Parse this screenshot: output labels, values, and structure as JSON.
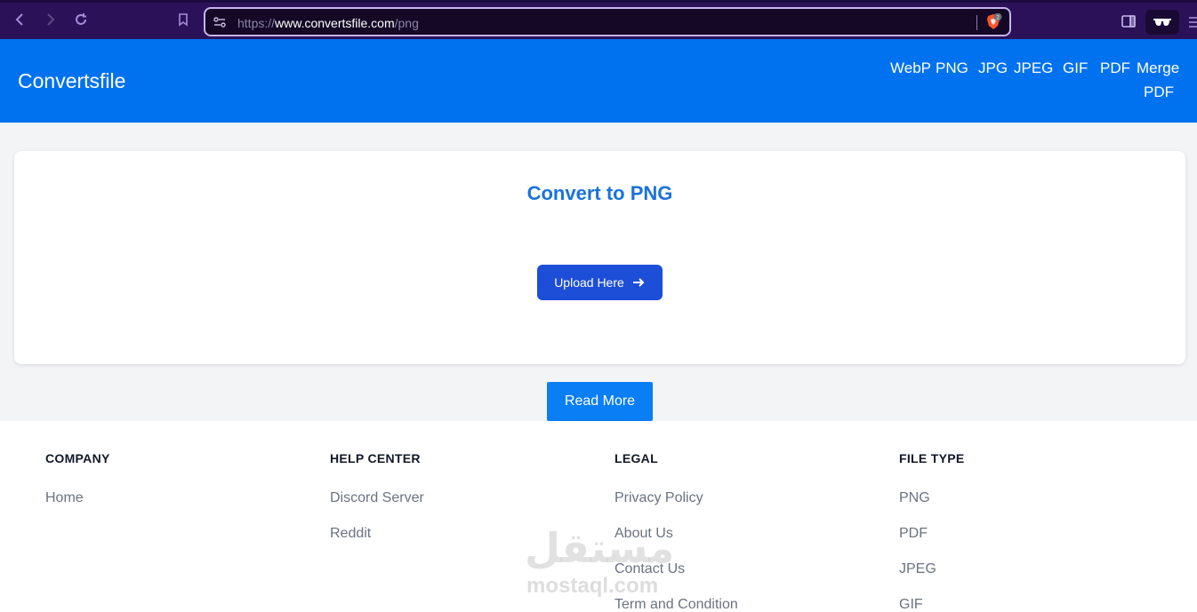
{
  "browser": {
    "url_scheme": "https://",
    "url_host": "www.convertsfile.com",
    "url_path": "/png",
    "shield_count": "2"
  },
  "header": {
    "brand": "Convertsfile",
    "nav": [
      "WebP",
      "PNG",
      "JPG",
      "JPEG",
      "GIF",
      "PDF",
      "Merge",
      "PDF"
    ]
  },
  "main": {
    "title": "Convert to PNG",
    "upload_label": "Upload Here",
    "read_more_label": "Read More"
  },
  "footer": {
    "columns": [
      {
        "heading": "COMPANY",
        "items": [
          "Home"
        ]
      },
      {
        "heading": "HELP CENTER",
        "items": [
          "Discord Server",
          "Reddit"
        ]
      },
      {
        "heading": "LEGAL",
        "items": [
          "Privacy Policy",
          "About Us",
          "Contact Us",
          "Term and Condition"
        ]
      },
      {
        "heading": "FILE TYPE",
        "items": [
          "PNG",
          "PDF",
          "JPEG",
          "GIF"
        ]
      }
    ]
  },
  "watermark": {
    "arabic": "مستقل",
    "latin": "mostaql.com"
  },
  "colors": {
    "header_bg": "#0172ef",
    "title_blue": "#1a73d9",
    "upload_btn": "#1d4ed8",
    "read_more_btn": "#0a7ef5",
    "page_bg": "#f3f4f6"
  }
}
